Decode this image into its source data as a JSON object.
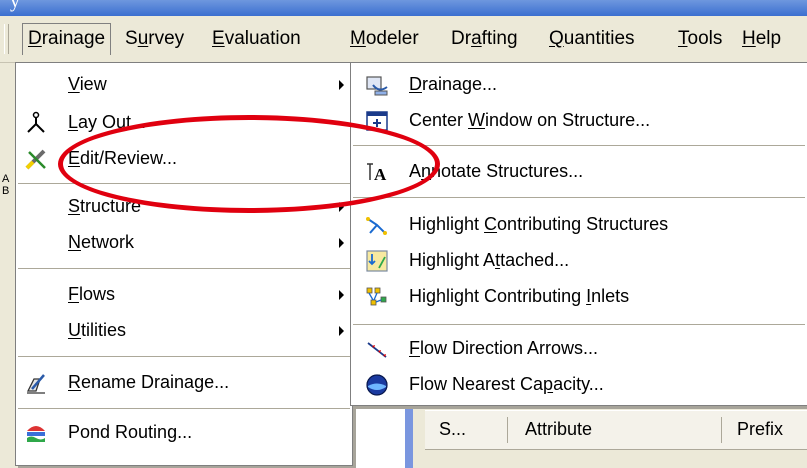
{
  "title_fragment": "y",
  "menubar": {
    "items": [
      {
        "label": "Drainage",
        "u": "D",
        "rest": "rainage",
        "active": true
      },
      {
        "label": "Survey",
        "pre": "S",
        "u": "u",
        "rest": "rvey"
      },
      {
        "label": "Evaluation",
        "u": "E",
        "rest": "valuation"
      },
      {
        "label": "Modeler",
        "u": "M",
        "rest": "odeler"
      },
      {
        "label": "Drafting",
        "pre": "Dr",
        "u": "a",
        "rest": "fting"
      },
      {
        "label": "Quantities",
        "u": "Q",
        "rest": "uantities"
      },
      {
        "label": "Tools",
        "u": "T",
        "rest": "ools"
      },
      {
        "label": "Help",
        "u": "H",
        "rest": "elp"
      }
    ]
  },
  "drainage_menu": {
    "items": [
      {
        "pre": "",
        "u": "V",
        "rest": "iew",
        "icon": null,
        "submenu": true
      },
      {
        "pre": "",
        "u": "L",
        "rest": "ay Out...",
        "icon": "layout-icon",
        "submenu": false
      },
      {
        "pre": "",
        "u": "E",
        "rest": "dit/Review...",
        "icon": "edit-review-icon",
        "submenu": false
      },
      {
        "pre": "",
        "u": "S",
        "rest": "tructure",
        "icon": null,
        "submenu": true
      },
      {
        "pre": "",
        "u": "N",
        "rest": "etwork",
        "icon": null,
        "submenu": true
      },
      {
        "pre": "",
        "u": "F",
        "rest": "lows",
        "icon": null,
        "submenu": true
      },
      {
        "pre": "",
        "u": "U",
        "rest": "tilities",
        "icon": null,
        "submenu": true
      },
      {
        "pre": "",
        "u": "R",
        "rest": "ename Drainage...",
        "icon": "rename-drainage-icon",
        "submenu": false
      },
      {
        "pre": "Pond Routing...",
        "u": "",
        "rest": "",
        "icon": "pond-routing-icon",
        "submenu": false
      }
    ]
  },
  "view_submenu": {
    "items": [
      {
        "pre": "",
        "u": "D",
        "rest": "rainage...",
        "icon": "drainage-view-icon"
      },
      {
        "pre": "Center ",
        "u": "W",
        "rest": "indow on Structure...",
        "icon": "center-window-icon"
      },
      {
        "pre": "A",
        "u": "n",
        "rest": "notate Structures...",
        "icon": "annotate-icon"
      },
      {
        "pre": "Highlight ",
        "u": "C",
        "rest": "ontributing Structures",
        "icon": "highlight-structures-icon"
      },
      {
        "pre": "Highlight A",
        "u": "t",
        "rest": "tached...",
        "icon": "highlight-attached-icon"
      },
      {
        "pre": "Highlight Contributing ",
        "u": "I",
        "rest": "nlets",
        "icon": "highlight-inlets-icon"
      },
      {
        "pre": "",
        "u": "F",
        "rest": "low Direction Arrows...",
        "icon": "flow-arrows-icon"
      },
      {
        "pre": "Flow Nearest Ca",
        "u": "p",
        "rest": "acity...",
        "icon": "flow-capacity-icon"
      }
    ]
  },
  "background_panel": {
    "col_s": "S...",
    "col_attribute": "Attribute",
    "col_prefix": "Prefix"
  },
  "left_toolbar_letters": [
    "A",
    "B"
  ],
  "colors": {
    "annotation": "#e0000f",
    "menu_bg": "#ffffff",
    "bar_bg": "#ece9d8"
  }
}
